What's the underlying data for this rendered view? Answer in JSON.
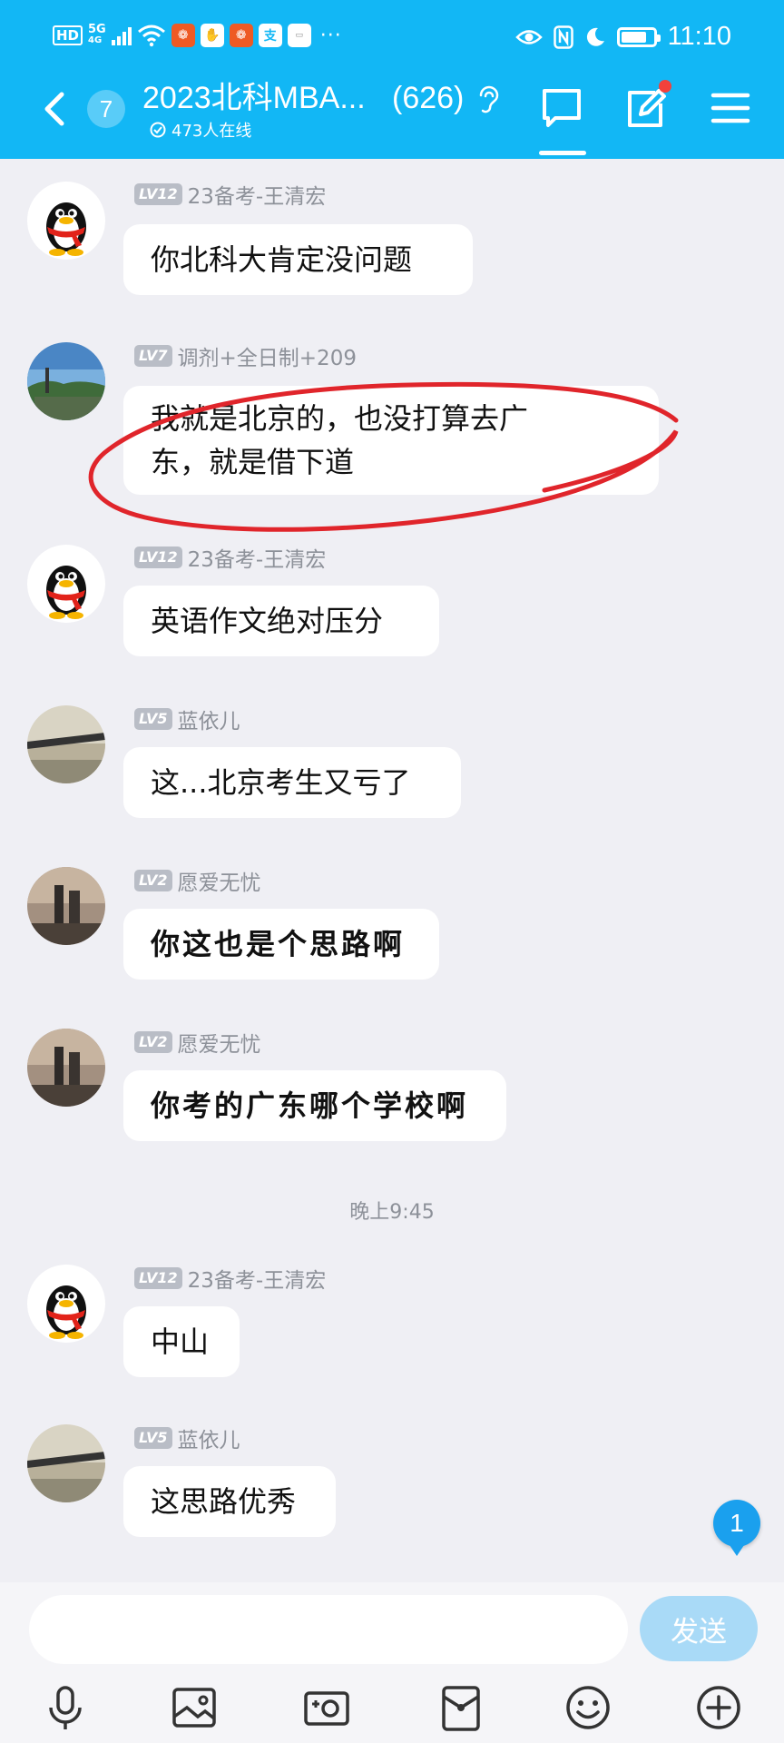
{
  "status_bar": {
    "left_indicators": [
      "HD",
      "5G",
      "4G"
    ],
    "time": "11:10",
    "battery_level": 0.8
  },
  "header": {
    "back_unread_count": "7",
    "group_name": "2023北科MBA...",
    "member_count": "(626)",
    "online_text": "473人在线"
  },
  "messages": [
    {
      "level": "LV12",
      "sender": "23备考-王清宏",
      "avatar": "qq-penguin",
      "lines": [
        "你北科大肯定没问题"
      ]
    },
    {
      "level": "LV7",
      "sender": "调剂+全日制+209",
      "avatar": "landscape-photo",
      "lines": [
        "我就是北京的，也没打算去广",
        "东，就是借下道"
      ]
    },
    {
      "level": "LV12",
      "sender": "23备考-王清宏",
      "avatar": "qq-penguin",
      "lines": [
        "英语作文绝对压分"
      ]
    },
    {
      "level": "LV5",
      "sender": "蓝依儿",
      "avatar": "seaside-photo",
      "lines": [
        "这...北京考生又亏了"
      ]
    },
    {
      "level": "LV2",
      "sender": "愿爱无忧",
      "avatar": "city-dusk-photo",
      "lines": [
        "你这也是个思路啊"
      ]
    },
    {
      "level": "LV2",
      "sender": "愿爱无忧",
      "avatar": "city-dusk-photo",
      "lines": [
        "你考的广东哪个学校啊"
      ]
    },
    {
      "level": "LV12",
      "sender": "23备考-王清宏",
      "avatar": "qq-penguin",
      "lines": [
        "中山"
      ]
    },
    {
      "level": "LV5",
      "sender": "蓝依儿",
      "avatar": "seaside-photo",
      "lines": [
        "这思路优秀"
      ]
    }
  ],
  "timestamp": "晚上9:45",
  "new_message_badge": "1",
  "input": {
    "value": "",
    "send_label": "发送"
  },
  "toolbar_icons": [
    "microphone-icon",
    "image-icon",
    "camera-icon",
    "red-packet-icon",
    "emoji-icon",
    "plus-icon"
  ],
  "colors": {
    "header": "#12b7f5",
    "background": "#efeff4",
    "annotation": "#e0252b",
    "send_button": "#a9daf7"
  }
}
